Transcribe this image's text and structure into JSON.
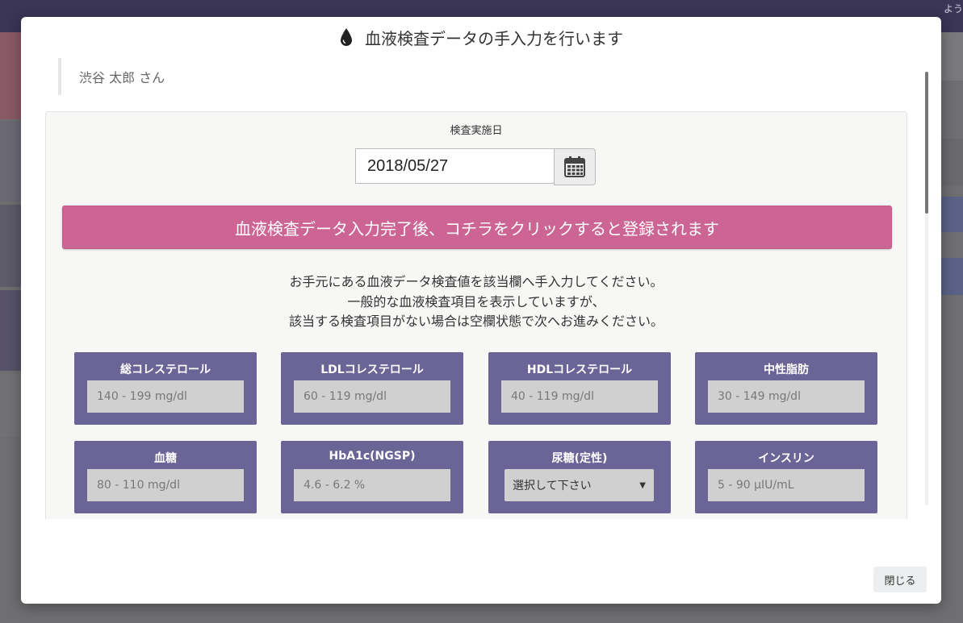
{
  "background": {
    "corner_text": "よう"
  },
  "modal": {
    "title": "血液検査データの手入力を行います",
    "patient_name": "渋谷 太郎 さん",
    "date_label": "検査実施日",
    "date_value": "2018/05/27",
    "submit_label": "血液検査データ入力完了後、コチラをクリックすると登録されます",
    "instructions": [
      "お手元にある血液データ検査値を該当欄へ手入力してください。",
      "一般的な血液検査項目を表示していますが、",
      "該当する検査項目がない場合は空欄状態で次へお進みください。"
    ],
    "fields": [
      {
        "label": "総コレステロール",
        "placeholder": "140 - 199 mg/dl"
      },
      {
        "label": "LDLコレステロール",
        "placeholder": "60 - 119 mg/dl"
      },
      {
        "label": "HDLコレステロール",
        "placeholder": "40 - 119 mg/dl"
      },
      {
        "label": "中性脂肪",
        "placeholder": "30 - 149 mg/dl"
      },
      {
        "label": "血糖",
        "placeholder": "80 - 110 mg/dl"
      },
      {
        "label": "HbA1c(NGSP)",
        "placeholder": "4.6 - 6.2 %"
      },
      {
        "label": "尿糖(定性)",
        "selected": "選択して下さい"
      },
      {
        "label": "インスリン",
        "placeholder": "5 - 90 μIU/mL"
      }
    ],
    "close_label": "閉じる"
  },
  "colors": {
    "submit": "#cc6593",
    "card": "#6b6497"
  }
}
